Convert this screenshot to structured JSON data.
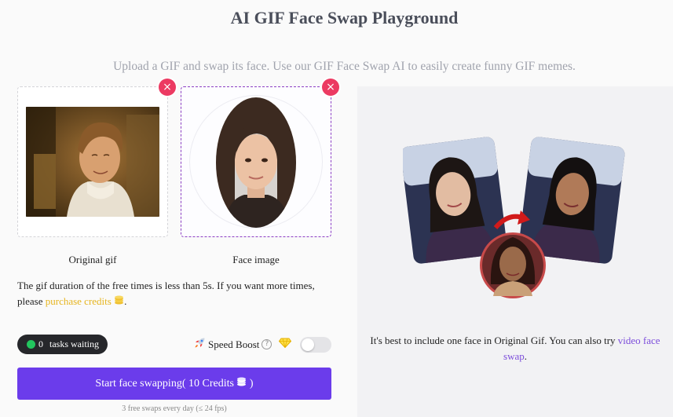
{
  "header": {
    "title": "AI GIF Face Swap Playground",
    "subtitle": "Upload a GIF and swap its face. Use our GIF Face Swap AI to easily create funny GIF memes."
  },
  "uploads": {
    "original_label": "Original gif",
    "face_label": "Face image",
    "remove_symbol": "×"
  },
  "notice": {
    "text": "The gif duration of the free times is less than 5s. If you want more times, please ",
    "link": "purchase credits",
    "icon": "coins-icon",
    "end": "."
  },
  "status": {
    "tasks_count": "0",
    "tasks_label": "tasks waiting",
    "speed_label": "Speed Boost",
    "speed_boost_on": false
  },
  "action": {
    "start_label": "Start face swapping( 10 Credits",
    "start_label_end": " )",
    "free_note": "3 free swaps every day (≤ 24 fps)"
  },
  "example": {
    "tip_text": "It's best to include one face in Original Gif. You can also try ",
    "tip_link": "video face swap",
    "tip_end": "."
  },
  "colors": {
    "accent": "#6b3ceb",
    "remove": "#ec3a62",
    "link_gold": "#e6b520",
    "status_green": "#22c55e"
  }
}
